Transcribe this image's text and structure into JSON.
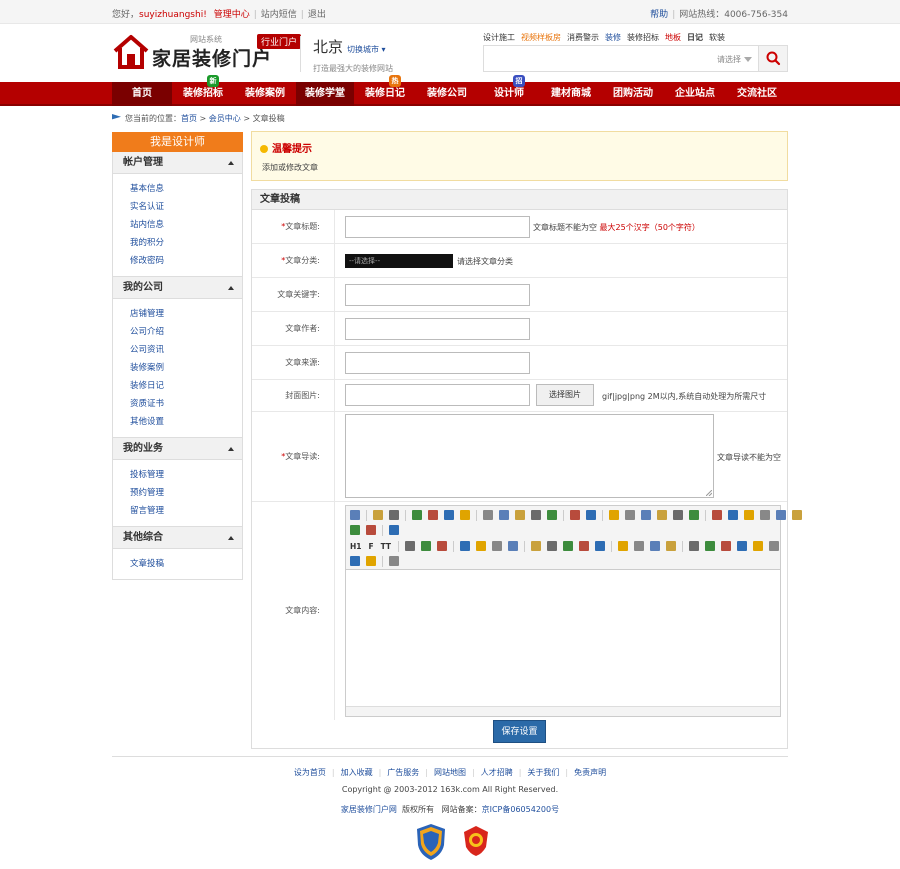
{
  "topbar": {
    "greeting": "您好，",
    "username": "suyizhuangshi!",
    "admin_center": "管理中心",
    "site_messages": "站内短信",
    "logout": "退出",
    "help": "帮助",
    "hotline": "网站热线：4006-756-354"
  },
  "header": {
    "logo_title": "家居装修门户",
    "logo_small": "网站系统",
    "logo_tag": "行业门户",
    "city": "北京",
    "switch_city": "切换城市",
    "slogan": "打造最强大的装修网站",
    "quick_links": [
      {
        "label": "设计施工",
        "style": ""
      },
      {
        "label": "视频样板房",
        "style": "orange"
      },
      {
        "label": "消费警示",
        "style": ""
      },
      {
        "label": "装修",
        "style": "blue"
      },
      {
        "label": "装修招标",
        "style": ""
      },
      {
        "label": "地板",
        "style": "red"
      },
      {
        "label": "日记",
        "style": "bold"
      },
      {
        "label": "软装",
        "style": ""
      }
    ],
    "search_select": "请选择"
  },
  "nav": {
    "items": [
      {
        "label": "首页",
        "width": 60,
        "active": true
      },
      {
        "label": "装修招标",
        "width": 62,
        "badge": "新",
        "badge_color": "#1a9a2a"
      },
      {
        "label": "装修案例",
        "width": 62
      },
      {
        "label": "装修学堂",
        "width": 58,
        "active": true
      },
      {
        "label": "装修日记",
        "width": 62,
        "badge": "热",
        "badge_color": "#e8740c"
      },
      {
        "label": "装修公司",
        "width": 62
      },
      {
        "label": "设计师",
        "width": 62,
        "badge": "招",
        "badge_color": "#3a4fc0"
      },
      {
        "label": "建材商城",
        "width": 62
      },
      {
        "label": "团购活动",
        "width": 62
      },
      {
        "label": "企业站点",
        "width": 62
      },
      {
        "label": "交流社区",
        "width": 62
      }
    ]
  },
  "breadcrumb": {
    "prefix": "您当前的位置：",
    "home": "首页",
    "member": "会员中心",
    "current": "文章投稿"
  },
  "sidebar": {
    "header": "我是设计师",
    "groups": [
      {
        "title": "帐户管理",
        "items": [
          "基本信息",
          "实名认证",
          "站内信息",
          "我的积分",
          "修改密码"
        ]
      },
      {
        "title": "我的公司",
        "items": [
          "店铺管理",
          "公司介绍",
          "公司资讯",
          "装修案例",
          "装修日记",
          "资质证书",
          "其他设置"
        ]
      },
      {
        "title": "我的业务",
        "items": [
          "投标管理",
          "预约管理",
          "留言管理"
        ]
      },
      {
        "title": "其他综合",
        "items": [
          "文章投稿"
        ]
      }
    ]
  },
  "tip": {
    "title": "温馨提示",
    "text": "添加或修改文章"
  },
  "form": {
    "title": "文章投稿",
    "title_label": "文章标题:",
    "title_help": "文章标题不能为空",
    "title_limit": "最大25个汉字（50个字符）",
    "category_label": "文章分类:",
    "category_select": "--请选择--",
    "category_help": "请选择文章分类",
    "keywords_label": "文章关键字:",
    "author_label": "文章作者:",
    "source_label": "文章来源:",
    "cover_label": "封面图片:",
    "cover_button": "选择图片",
    "cover_help": "gif|jpg|png 2M以内,系统自动处理为所需尺寸",
    "intro_label": "文章导读:",
    "intro_help": "文章导读不能为空",
    "content_label": "文章内容:",
    "toolbar_text": [
      "H1",
      "F",
      "TT"
    ],
    "save_button": "保存设置"
  },
  "footer": {
    "links": [
      "设为首页",
      "加入收藏",
      "广告服务",
      "网站地图",
      "人才招聘",
      "关于我们",
      "免责声明"
    ],
    "copyright": "Copyright @ 2003-2012 163k.com All Right Reserved.",
    "site_name": "家居装修门户网",
    "rights": "版权所有",
    "record_label": "网站备案：",
    "record_no": "京ICP备06054200号"
  }
}
